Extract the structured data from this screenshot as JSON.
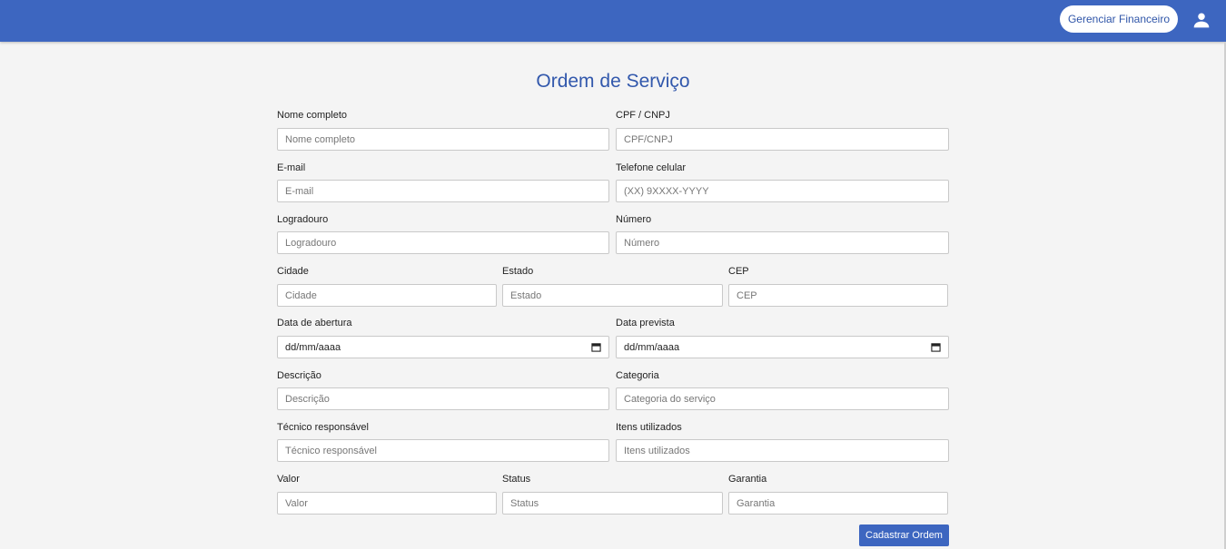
{
  "header": {
    "finance_button": "Gerenciar Financeiro",
    "user_icon": "person-icon"
  },
  "form": {
    "title": "Ordem de Serviço",
    "nome_label": "Nome completo",
    "nome_placeholder": "Nome completo",
    "cpf_label": "CPF / CNPJ",
    "cpf_placeholder": "CPF/CNPJ",
    "email_label": "E-mail",
    "email_placeholder": "E-mail",
    "telefone_label": "Telefone celular",
    "telefone_placeholder": "(XX) 9XXXX-YYYY",
    "logradouro_label": "Logradouro",
    "logradouro_placeholder": "Logradouro",
    "numero_label": "Número",
    "numero_placeholder": "Número",
    "cidade_label": "Cidade",
    "cidade_placeholder": "Cidade",
    "estado_label": "Estado",
    "estado_placeholder": "Estado",
    "cep_label": "CEP",
    "cep_placeholder": "CEP",
    "abertura_label": "Data de abertura",
    "abertura_value": "dd/mm/aaaa",
    "prevista_label": "Data prevista",
    "prevista_value": "dd/mm/aaaa",
    "descricao_label": "Descrição",
    "descricao_placeholder": "Descrição",
    "categoria_label": "Categoria",
    "categoria_placeholder": "Categoria do serviço",
    "tecnico_label": "Técnico responsável",
    "tecnico_placeholder": "Técnico responsável",
    "itens_label": "Itens utilizados",
    "itens_placeholder": "Itens utilizados",
    "valor_label": "Valor",
    "valor_placeholder": "Valor",
    "status_label": "Status",
    "status_placeholder": "Status",
    "garantia_label": "Garantia",
    "garantia_placeholder": "Garantia",
    "submit_label": "Cadastrar Ordem"
  }
}
